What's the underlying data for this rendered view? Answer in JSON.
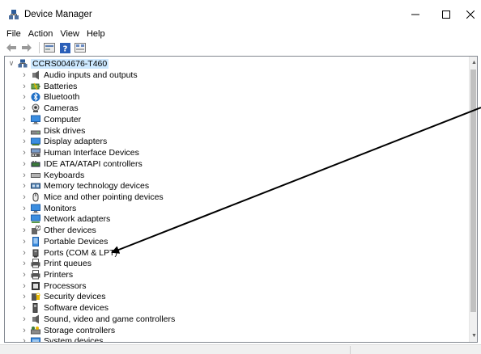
{
  "window": {
    "title": "Device Manager",
    "icon": "device-manager-icon",
    "controls": [
      "minimize-icon",
      "maximize-icon",
      "close-icon"
    ]
  },
  "menu": {
    "items": [
      {
        "label": "File"
      },
      {
        "label": "Action"
      },
      {
        "label": "View"
      },
      {
        "label": "Help"
      }
    ]
  },
  "toolbar": {
    "buttons": [
      "back-icon",
      "forward-icon",
      "properties-icon",
      "help-icon",
      "scan-icon"
    ]
  },
  "tree": {
    "root": {
      "label": "CCRS004676-T460",
      "icon": "computer-icon",
      "expanded": true,
      "selected": true
    },
    "categories": [
      {
        "label": "Audio inputs and outputs",
        "icon": "audio-icon"
      },
      {
        "label": "Batteries",
        "icon": "battery-icon"
      },
      {
        "label": "Bluetooth",
        "icon": "bluetooth-icon"
      },
      {
        "label": "Cameras",
        "icon": "camera-icon"
      },
      {
        "label": "Computer",
        "icon": "monitor-icon"
      },
      {
        "label": "Disk drives",
        "icon": "disk-icon"
      },
      {
        "label": "Display adapters",
        "icon": "display-adapter-icon"
      },
      {
        "label": "Human Interface Devices",
        "icon": "hid-icon"
      },
      {
        "label": "IDE ATA/ATAPI controllers",
        "icon": "ide-controller-icon"
      },
      {
        "label": "Keyboards",
        "icon": "keyboard-icon"
      },
      {
        "label": "Memory technology devices",
        "icon": "memory-icon"
      },
      {
        "label": "Mice and other pointing devices",
        "icon": "mouse-icon"
      },
      {
        "label": "Monitors",
        "icon": "monitor-icon"
      },
      {
        "label": "Network adapters",
        "icon": "network-icon"
      },
      {
        "label": "Other devices",
        "icon": "unknown-device-icon"
      },
      {
        "label": "Portable Devices",
        "icon": "portable-device-icon"
      },
      {
        "label": "Ports (COM & LPT)",
        "icon": "port-icon"
      },
      {
        "label": "Print queues",
        "icon": "printer-icon"
      },
      {
        "label": "Printers",
        "icon": "printer-icon"
      },
      {
        "label": "Processors",
        "icon": "processor-icon"
      },
      {
        "label": "Security devices",
        "icon": "security-icon"
      },
      {
        "label": "Software devices",
        "icon": "software-icon"
      },
      {
        "label": "Sound, video and game controllers",
        "icon": "sound-icon"
      },
      {
        "label": "Storage controllers",
        "icon": "storage-icon"
      },
      {
        "label": "System devices",
        "icon": "system-icon"
      }
    ]
  },
  "colors": {
    "selection": "#cce8ff",
    "arrow": "#000000",
    "accent": "#0078d7"
  }
}
